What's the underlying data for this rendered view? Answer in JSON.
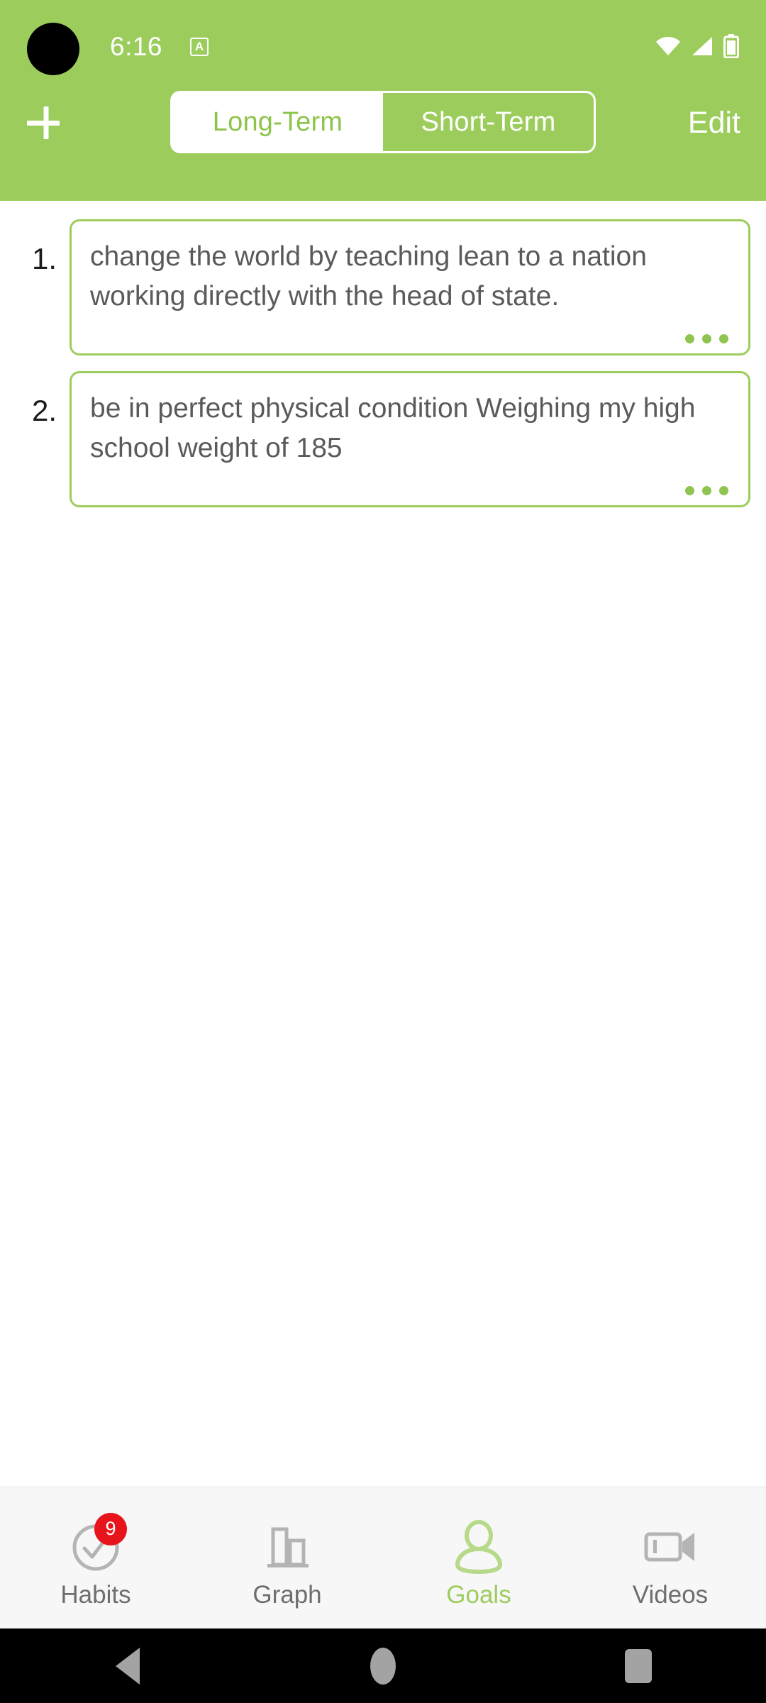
{
  "status_bar": {
    "time": "6:16",
    "app_indicator_letter": "A",
    "icons": [
      "wifi-icon",
      "cellular-signal-icon",
      "battery-icon"
    ]
  },
  "header": {
    "add_button_label": "+",
    "add_icon": "plus-icon",
    "edit_button_label": "Edit",
    "accent_color": "#9ccd5c",
    "segmented_control": {
      "options": [
        {
          "label": "Long-Term",
          "selected": false
        },
        {
          "label": "Short-Term",
          "selected": true
        }
      ],
      "selected_value": "Short-Term"
    }
  },
  "goals": [
    {
      "number": "1.",
      "text": "change the world by teaching lean to a nation working directly with the head of state.",
      "more_icon": "more-options-icon"
    },
    {
      "number": "2.",
      "text": "be in perfect physical condition Weighing my high school weight of 185",
      "more_icon": "more-options-icon"
    }
  ],
  "tab_bar": {
    "active_tab": "Goals",
    "tabs": [
      {
        "label": "Habits",
        "icon": "check-circle-icon",
        "badge": "9",
        "active": false
      },
      {
        "label": "Graph",
        "icon": "bar-chart-icon",
        "badge": "",
        "active": false
      },
      {
        "label": "Goals",
        "icon": "person-icon",
        "badge": "",
        "active": true
      },
      {
        "label": "Videos",
        "icon": "video-camera-icon",
        "badge": "",
        "active": false
      }
    ],
    "badge_color": "#e8141c",
    "active_color": "#9ccd5c",
    "inactive_color": "#6e6e6e"
  },
  "system_nav": {
    "buttons": [
      {
        "name": "back",
        "icon": "triangle-back-icon"
      },
      {
        "name": "home",
        "icon": "circle-home-icon"
      },
      {
        "name": "recents",
        "icon": "square-recents-icon"
      }
    ]
  }
}
